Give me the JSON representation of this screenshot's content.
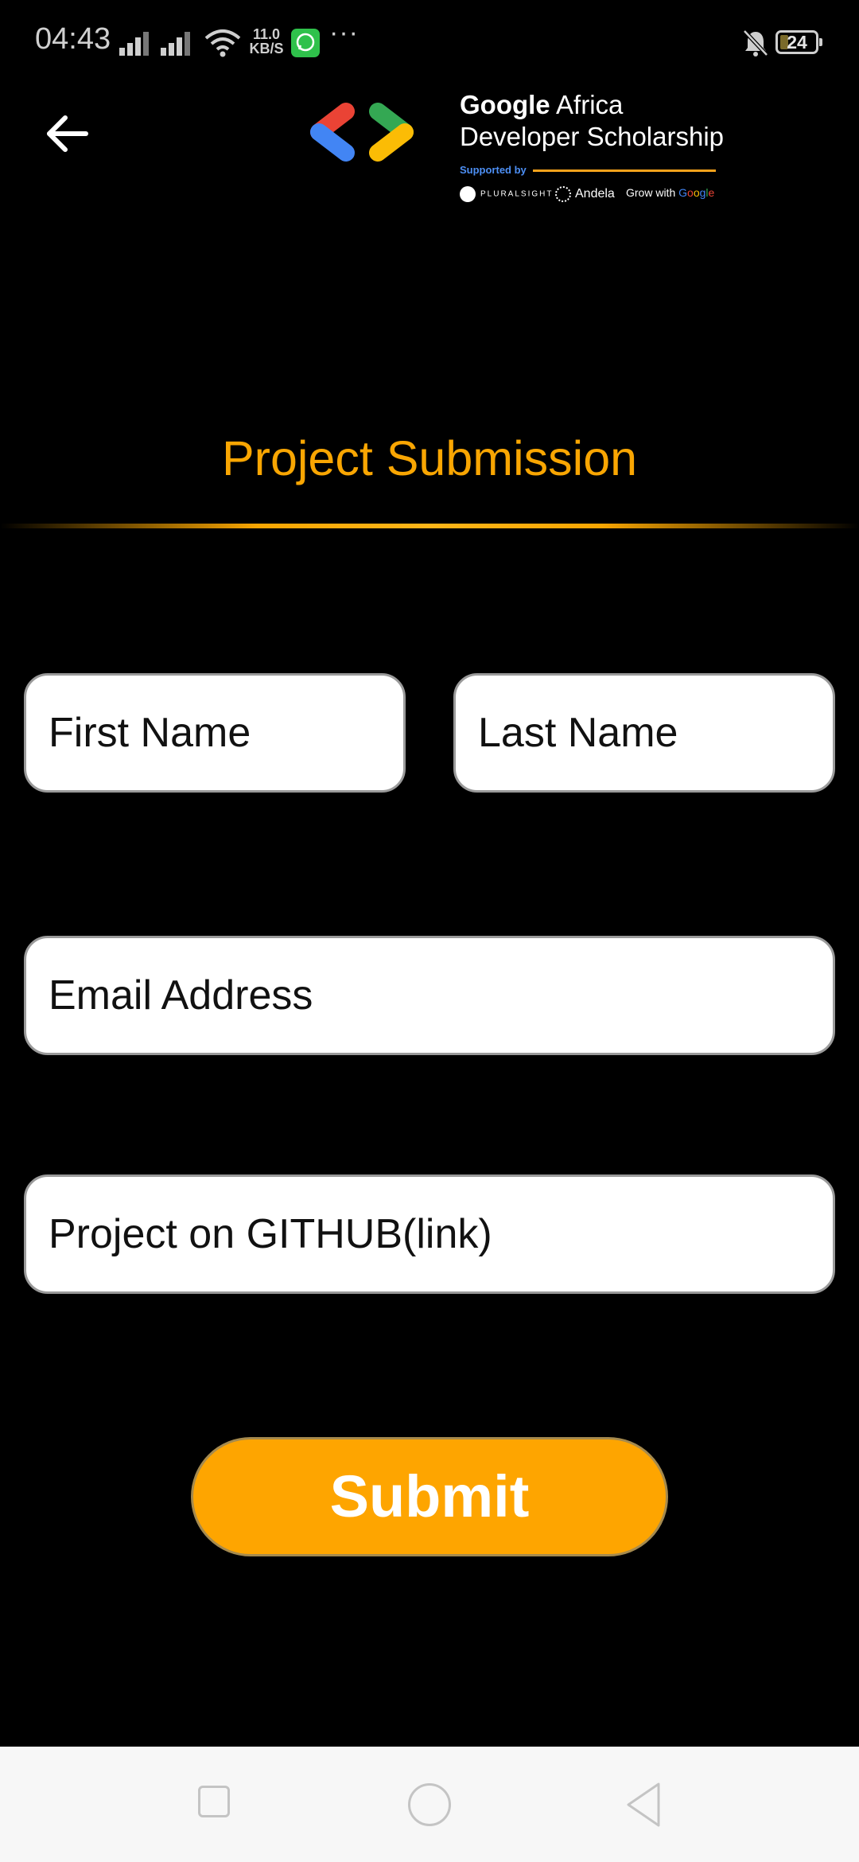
{
  "status_bar": {
    "time": "04:43",
    "network_speed_value": "11.0",
    "network_speed_unit": "KB/S",
    "overflow": "···",
    "battery_level": "24",
    "battery_fraction": 0.24,
    "icons": [
      "signal-icon",
      "signal-icon",
      "wifi-icon",
      "whatsapp-icon",
      "bell-off-icon",
      "battery-icon"
    ]
  },
  "header": {
    "back_icon": "arrow-left-icon",
    "logo": {
      "title_brand": "Google",
      "title_rest": "Africa",
      "subtitle": "Developer Scholarship",
      "supported_by": "Supported by",
      "sponsors": {
        "pluralsight": "PLURALSIGHT",
        "andela": "Andela",
        "grow_prefix": "Grow with",
        "grow_brand": [
          "G",
          "o",
          "o",
          "g",
          "l",
          "e"
        ]
      },
      "colors": {
        "blue": "#4285F4",
        "red": "#EA4335",
        "green": "#34A853",
        "yellow": "#FBBC05"
      }
    }
  },
  "main": {
    "title": "Project Submission",
    "accent_color": "#f9a602",
    "form": {
      "first_name_placeholder": "First Name",
      "last_name_placeholder": "Last Name",
      "email_placeholder": "Email Address",
      "github_placeholder": "Project on GITHUB(link)",
      "submit_label": "Submit",
      "submit_color": "#fea500"
    }
  },
  "nav_bar": {
    "items": [
      "recents-square-icon",
      "home-circle-icon",
      "back-triangle-icon"
    ]
  }
}
